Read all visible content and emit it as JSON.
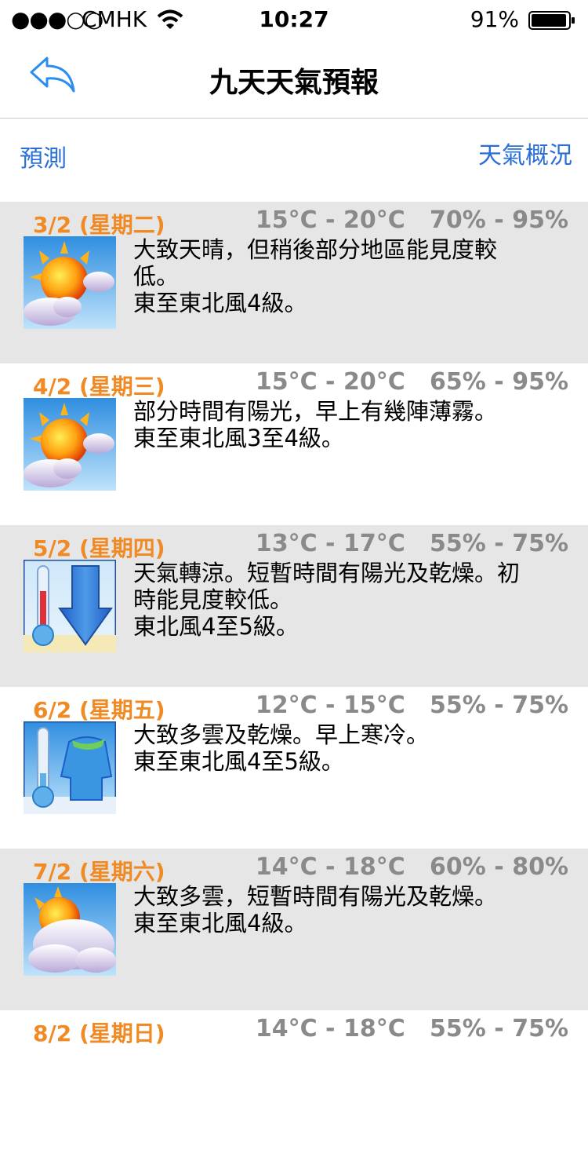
{
  "status_bar": {
    "signal": "●●●○○",
    "carrier": "CMHK",
    "time": "10:27",
    "battery": "91%"
  },
  "nav": {
    "title": "九天天氣預報",
    "back_icon": "back-arrow-icon"
  },
  "tabs": {
    "forecast": "預測",
    "overview": "天氣概況"
  },
  "colors": {
    "date": "#f08a24",
    "temps": "#8a8a8a",
    "link": "#2a6fd6",
    "row_gray": "#e6e6e6"
  },
  "forecast": [
    {
      "date": "3/2 (星期二)",
      "range": "15°C - 20°C   70% - 95%",
      "icon": "sunny-periods-icon",
      "lines": [
        "大致天晴，但稍後部分地區能見度較",
        "低。",
        "東至東北風4級。"
      ]
    },
    {
      "date": "4/2 (星期三)",
      "range": "15°C - 20°C   65% - 95%",
      "icon": "sunny-periods-icon",
      "lines": [
        "部分時間有陽光，早上有幾陣薄霧。",
        "東至東北風3至4級。"
      ]
    },
    {
      "date": "5/2 (星期四)",
      "range": "13°C - 17°C   55% - 75%",
      "icon": "cool-icon",
      "lines": [
        "天氣轉涼。短暫時間有陽光及乾燥。初",
        "時能見度較低。",
        "東北風4至5級。"
      ]
    },
    {
      "date": "6/2 (星期五)",
      "range": "12°C - 15°C   55% - 75%",
      "icon": "cold-icon",
      "lines": [
        "大致多雲及乾燥。早上寒冷。",
        "東至東北風4至5級。"
      ]
    },
    {
      "date": "7/2 (星期六)",
      "range": "14°C - 18°C   60% - 80%",
      "icon": "mainly-cloudy-icon",
      "lines": [
        "大致多雲，短暫時間有陽光及乾燥。",
        "東至東北風4級。"
      ]
    },
    {
      "date": "8/2 (星期日)",
      "range": "14°C - 18°C   55% - 75%",
      "icon": "",
      "lines": []
    }
  ]
}
